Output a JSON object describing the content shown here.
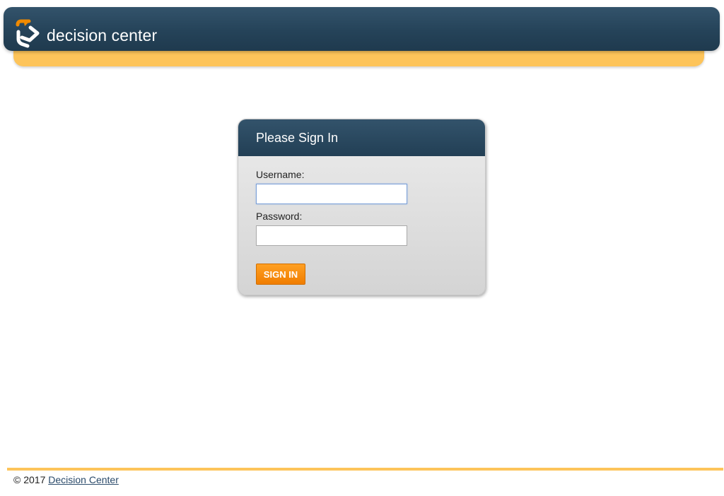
{
  "header": {
    "logo_text": "decision center",
    "colors": {
      "bar": "#254359",
      "accent": "#fdc45a",
      "logo_orange": "#f08a00"
    }
  },
  "login": {
    "title": "Please Sign In",
    "username_label": "Username:",
    "username_value": "",
    "password_label": "Password:",
    "password_value": "",
    "sign_in_label": "SIGN IN",
    "button_color": "#f58a0b"
  },
  "footer": {
    "copyright": "© 2017",
    "link_text": "Decision Center"
  },
  "icons": {
    "logo": "decision-center-logo-icon"
  }
}
